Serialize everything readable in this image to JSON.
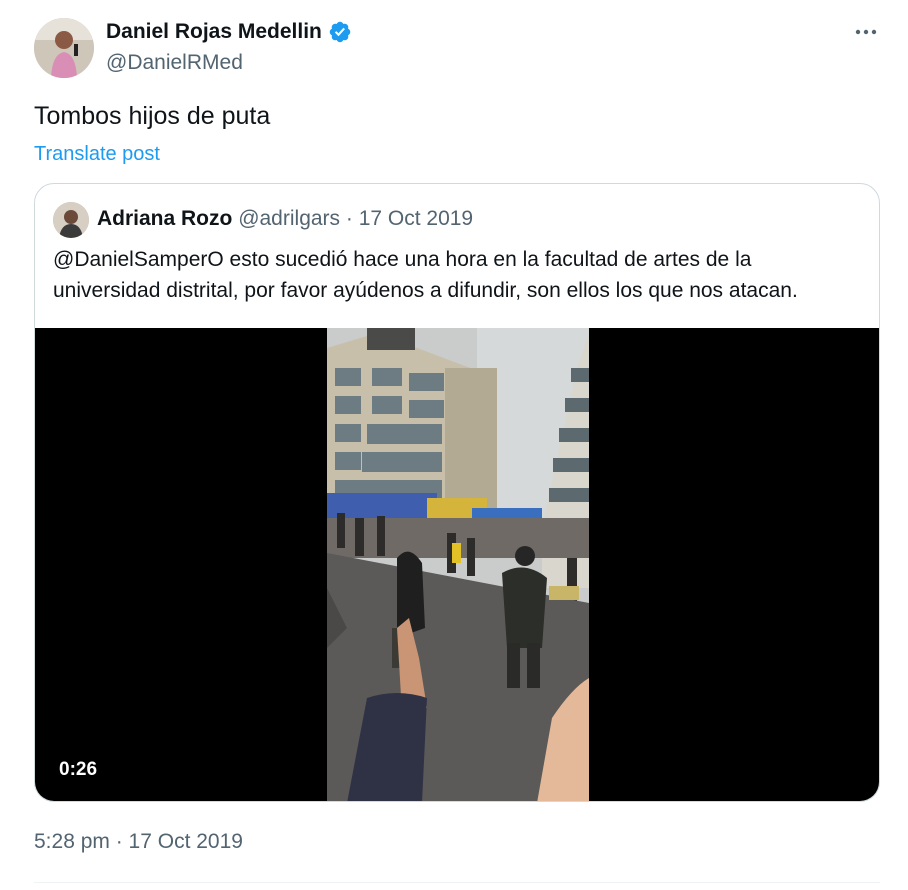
{
  "author": {
    "display_name": "Daniel Rojas Medellin",
    "handle": "@DanielRMed",
    "verified": true,
    "verified_color": "#1d9bf0"
  },
  "post": {
    "text": "Tombos hijos de puta",
    "translate_label": "Translate post",
    "timestamp": "5:28 pm · 17 Oct 2019"
  },
  "quoted_post": {
    "display_name": "Adriana Rozo",
    "handle_date": "@adrilgars · 17 Oct 2019",
    "text": "@DanielSamperO esto sucedió hace una hora en la facultad de artes de la universidad distrital, por favor ayúdenos a difundir, son ellos los que nos atacan.",
    "video_duration": "0:26"
  },
  "icons": {
    "more": "more-horizontal-icon",
    "verified": "verified-badge-icon"
  },
  "colors": {
    "link": "#1d9bf0",
    "secondary_text": "#536471",
    "border": "#cfd9de"
  }
}
